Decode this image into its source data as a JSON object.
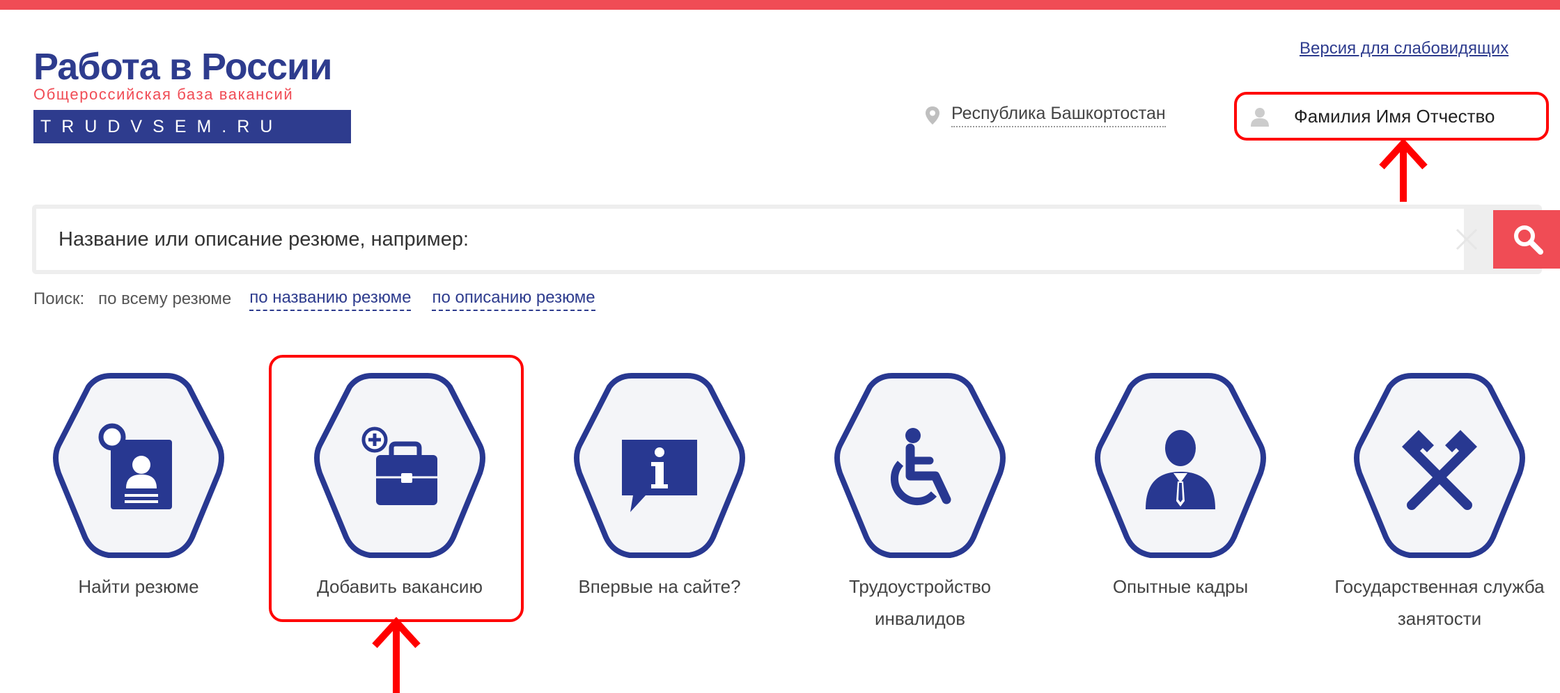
{
  "colors": {
    "accent_red": "#f04c55",
    "brand_blue": "#2e3c8e",
    "highlight_red": "#ff0000",
    "hex_border": "#283891",
    "hex_fill": "#f4f5f8"
  },
  "logo": {
    "title": "Работа в России",
    "subtitle": "Общероссийская база вакансий",
    "domain": "TRUDVSEM.RU"
  },
  "header": {
    "accessibility_link": "Версия для слабовидящих",
    "region": "Республика Башкортостан",
    "user_name": "Фамилия Имя Отчество"
  },
  "search": {
    "placeholder": "Название или описание резюме, например:",
    "scope_label": "Поиск:",
    "scope_all": "по всему резюме",
    "scope_title": "по названию резюме",
    "scope_description": "по описанию резюме"
  },
  "tiles": [
    {
      "icon": "find-resume-icon",
      "label": "Найти резюме"
    },
    {
      "icon": "add-vacancy-icon",
      "label": "Добавить вакансию"
    },
    {
      "icon": "info-icon",
      "label": "Впервые на сайте?"
    },
    {
      "icon": "wheelchair-icon",
      "label": "Трудоустройство инвалидов"
    },
    {
      "icon": "experienced-staff-icon",
      "label": "Опытные кадры"
    },
    {
      "icon": "tools-icon",
      "label": "Государственная служба занятости"
    }
  ]
}
